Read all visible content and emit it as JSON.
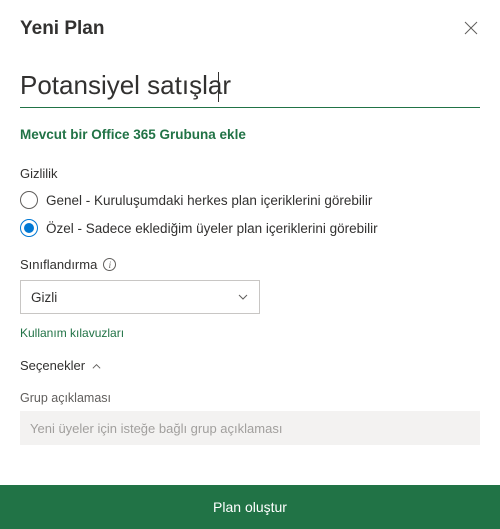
{
  "header": {
    "title": "Yeni Plan"
  },
  "plan_name": {
    "value": "Potansiyel satışlar"
  },
  "add_group_link": "Mevcut bir Office 365 Grubuna ekle",
  "privacy": {
    "label": "Gizlilik",
    "options": [
      {
        "label": "Genel - Kuruluşumdaki herkes plan içeriklerini görebilir",
        "checked": false
      },
      {
        "label": "Özel - Sadece eklediğim üyeler plan içeriklerini görebilir",
        "checked": true
      }
    ]
  },
  "classification": {
    "label": "Sınıflandırma",
    "selected": "Gizli",
    "guidelines_link": "Kullanım kılavuzları"
  },
  "options_toggle": "Seçenekler",
  "group_description": {
    "label": "Grup açıklaması",
    "placeholder": "Yeni üyeler için isteğe bağlı grup açıklaması",
    "value": ""
  },
  "footer": {
    "create_label": "Plan oluştur"
  },
  "colors": {
    "accent": "#217346",
    "blue": "#0078d4"
  }
}
